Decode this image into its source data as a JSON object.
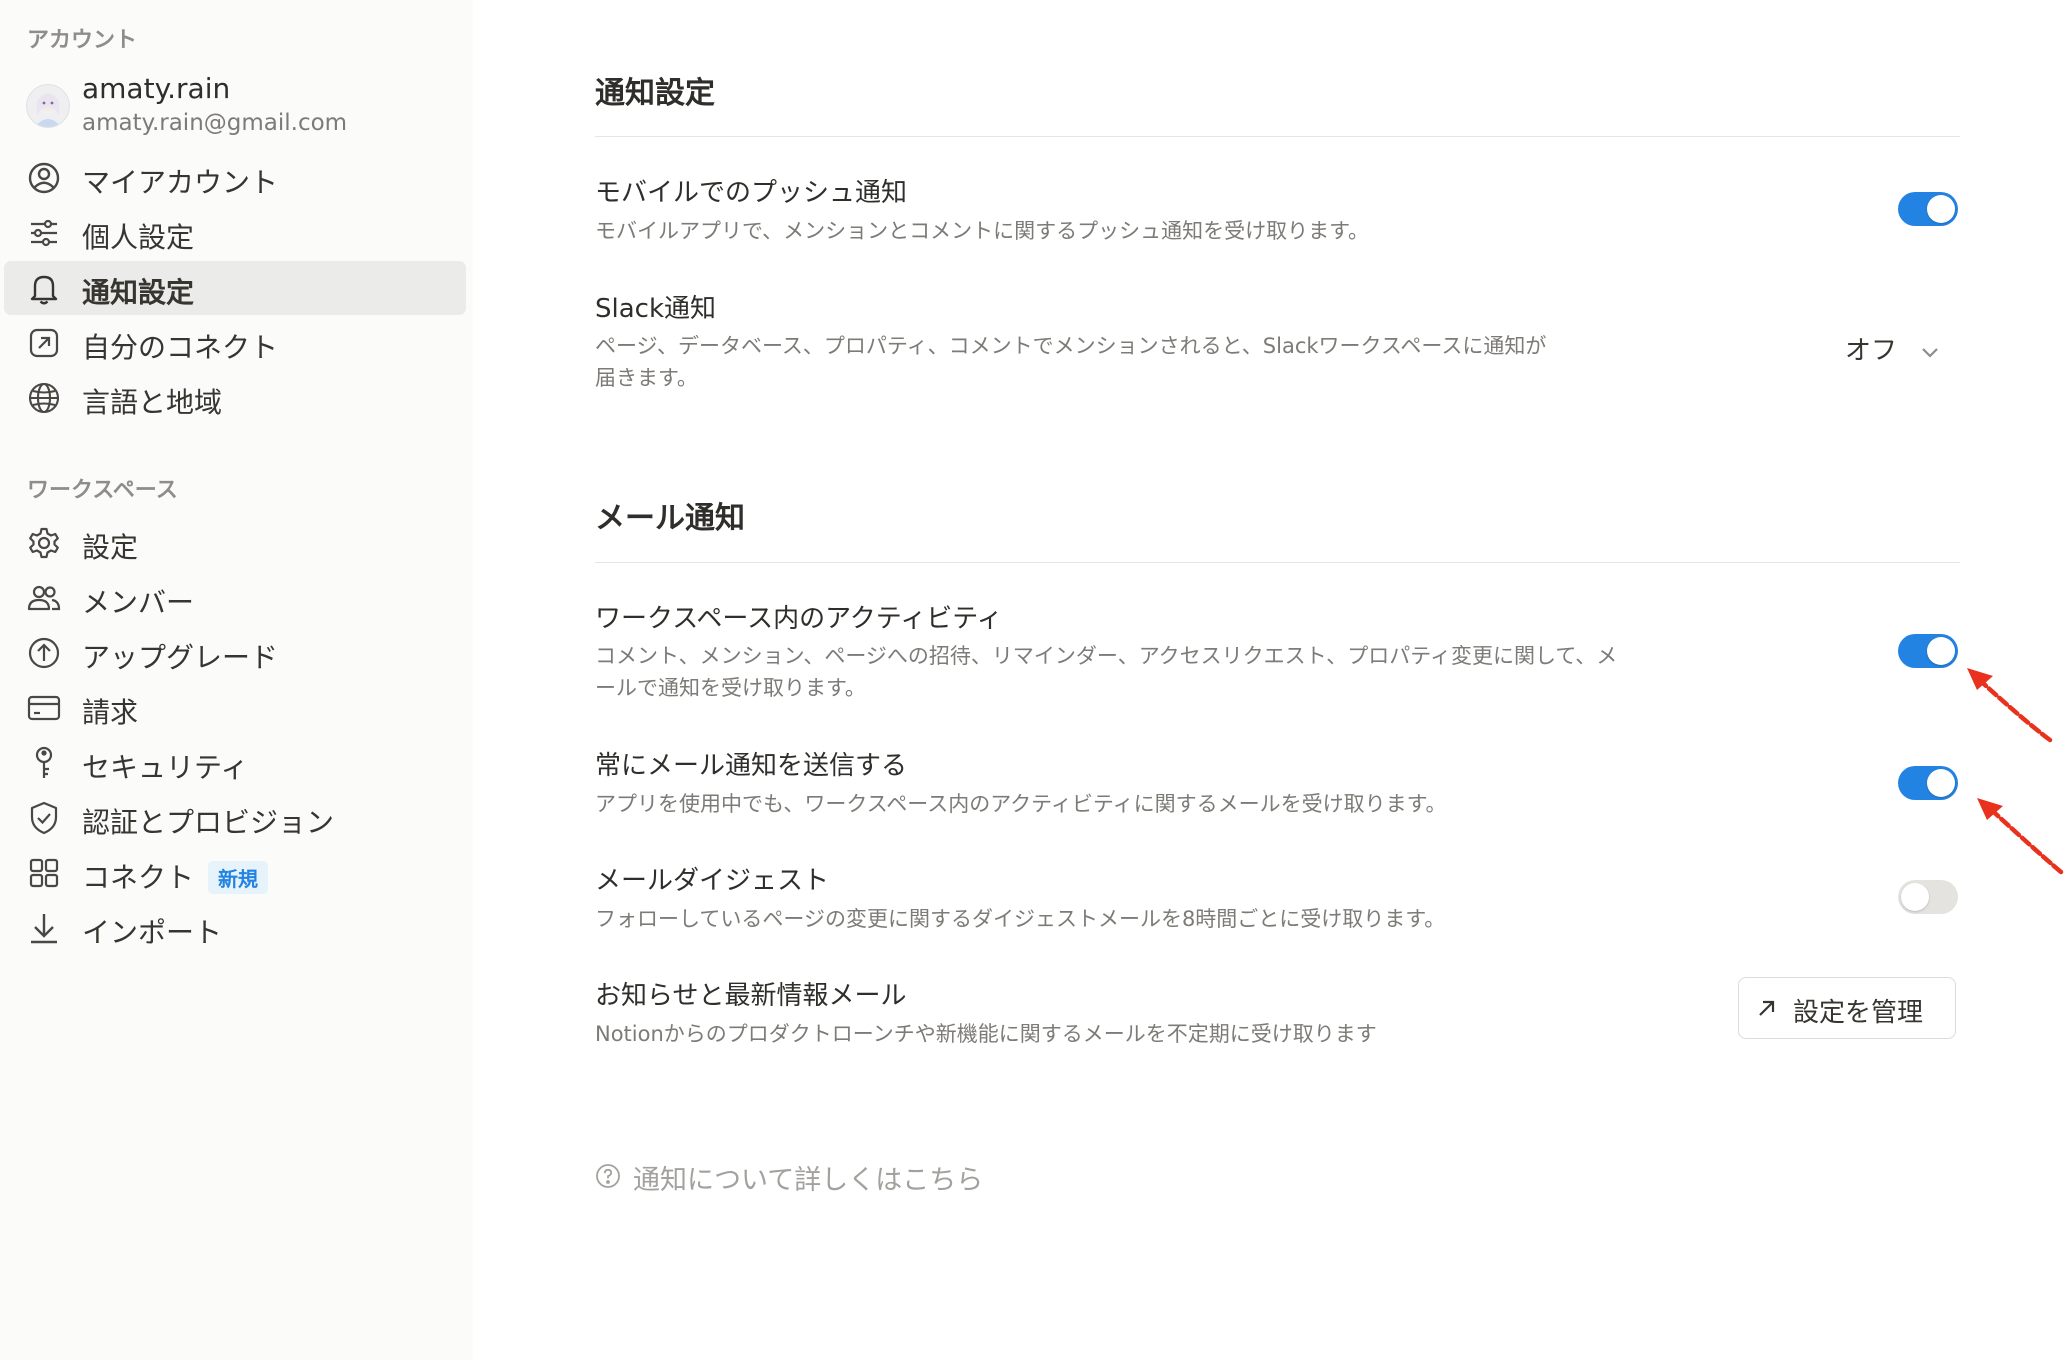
{
  "sidebar": {
    "account_section": "アカウント",
    "profile": {
      "name": "amaty.rain",
      "email": "amaty.rain@gmail.com"
    },
    "account_items": [
      {
        "label": "マイアカウント",
        "icon": "user-circle-icon"
      },
      {
        "label": "個人設定",
        "icon": "sliders-icon"
      },
      {
        "label": "通知設定",
        "icon": "bell-icon",
        "active": true
      },
      {
        "label": "自分のコネクト",
        "icon": "arrow-up-right-box-icon"
      },
      {
        "label": "言語と地域",
        "icon": "globe-icon"
      }
    ],
    "workspace_section": "ワークスペース",
    "workspace_items": [
      {
        "label": "設定",
        "icon": "gear-icon"
      },
      {
        "label": "メンバー",
        "icon": "people-icon"
      },
      {
        "label": "アップグレード",
        "icon": "arrow-up-circle-icon"
      },
      {
        "label": "請求",
        "icon": "credit-card-icon"
      },
      {
        "label": "セキュリティ",
        "icon": "key-icon"
      },
      {
        "label": "認証とプロビジョン",
        "icon": "shield-check-icon"
      },
      {
        "label": "コネクト",
        "icon": "grid-icon",
        "badge": "新規"
      },
      {
        "label": "インポート",
        "icon": "download-icon"
      }
    ]
  },
  "main": {
    "notifications_title": "通知設定",
    "mobile_push": {
      "title": "モバイルでのプッシュ通知",
      "description": "モバイルアプリで、メンションとコメントに関するプッシュ通知を受け取ります。",
      "enabled": true
    },
    "slack": {
      "title": "Slack通知",
      "description_line1": "ページ、データベース、プロパティ、コメントでメンションされると、Slackワークスペースに通知が",
      "description_line2": "届きます。",
      "value": "オフ"
    },
    "email_title": "メール通知",
    "workspace_activity": {
      "title": "ワークスペース内のアクティビティ",
      "description_line1": "コメント、メンション、ページへの招待、リマインダー、アクセスリクエスト、プロパティ変更に関して、メ",
      "description_line2": "ールで通知を受け取ります。",
      "enabled": true
    },
    "always_email": {
      "title": "常にメール通知を送信する",
      "description": "アプリを使用中でも、ワークスペース内のアクティビティに関するメールを受け取ります。",
      "enabled": true
    },
    "digest": {
      "title": "メールダイジェスト",
      "description": "フォローしているページの変更に関するダイジェストメールを8時間ごとに受け取ります。",
      "enabled": false
    },
    "news": {
      "title": "お知らせと最新情報メール",
      "description": "Notionからのプロダクトローンチや新機能に関するメールを不定期に受け取ります",
      "button_label": "設定を管理"
    },
    "help_link": "通知について詳しくはこちら"
  },
  "colors": {
    "accent": "#2383e2",
    "toggle_off": "#e4e3e0",
    "annotation_arrow": "#e8321e"
  }
}
